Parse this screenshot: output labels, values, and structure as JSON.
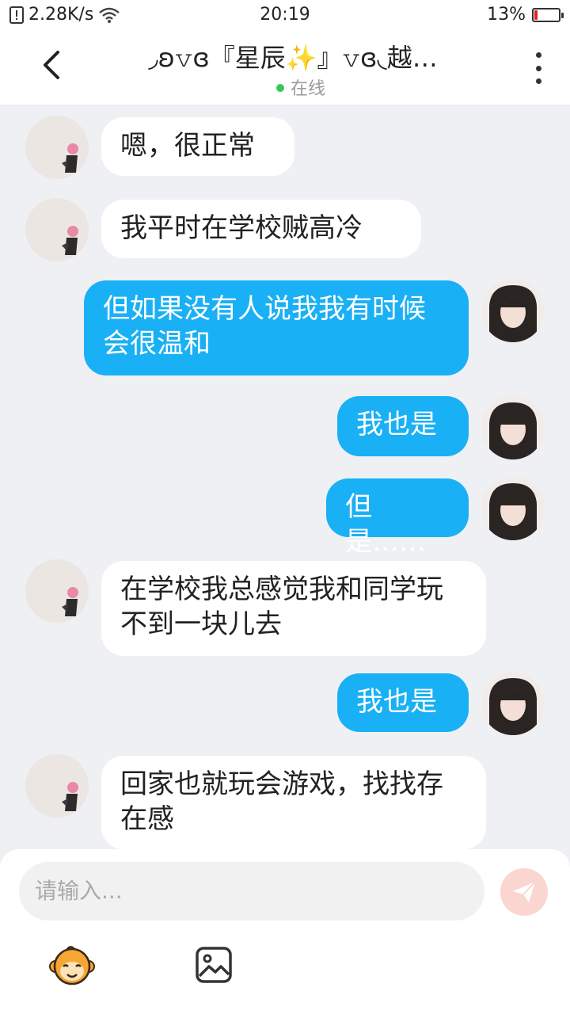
{
  "status_bar": {
    "speed": "2.28K/s",
    "time": "20:19",
    "battery": "13%",
    "battery_level": 0.13
  },
  "header": {
    "title": "◞ʚ𝚟ɞ『星辰✨』𝚟ɞ◟越…",
    "online": "在线"
  },
  "messages": [
    {
      "side": "other",
      "text": "嗯，很正常"
    },
    {
      "side": "other",
      "text": "我平时在学校贼高冷"
    },
    {
      "side": "me",
      "text": "但如果没有人说我我有时候会很温和"
    },
    {
      "side": "me",
      "text": "我也是"
    },
    {
      "side": "me",
      "text": "但是……"
    },
    {
      "side": "other",
      "text": "在学校我总感觉我和同学玩不到一块儿去"
    },
    {
      "side": "me",
      "text": "我也是"
    },
    {
      "side": "other",
      "text": "回家也就玩会游戏，找找存在感"
    }
  ],
  "input": {
    "placeholder": "请输入..."
  },
  "colors": {
    "accent": "#1ab0f5",
    "send": "#fbd5cf",
    "online": "#35c759"
  }
}
